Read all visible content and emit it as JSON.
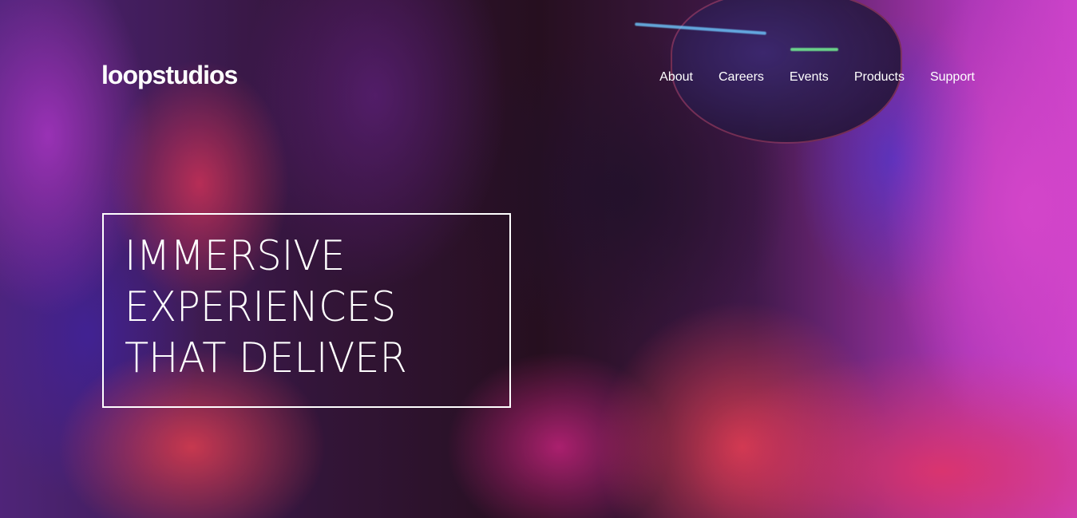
{
  "header": {
    "logo": "loopstudios",
    "nav": [
      "About",
      "Careers",
      "Events",
      "Products",
      "Support"
    ]
  },
  "hero": {
    "headline_lines": [
      "IMMERSIVE",
      "EXPERIENCES",
      "THAT DELIVER"
    ]
  },
  "colors": {
    "text": "#ffffff",
    "accent_magenta": "#e84ce6",
    "accent_red": "#ff3c78",
    "accent_blue": "#5a3ce6"
  }
}
